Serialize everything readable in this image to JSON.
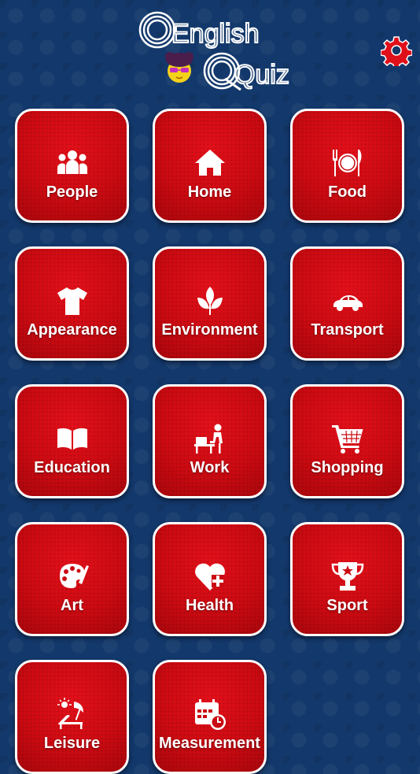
{
  "app": {
    "logo_line1": "English",
    "logo_line2": "Quiz"
  },
  "header": {
    "settings_icon": "gear-icon"
  },
  "colors": {
    "background": "#13386b",
    "tile": "#d50b14",
    "tile_border": "#ffffff",
    "settings": "#e0101a"
  },
  "categories": [
    {
      "label": "People",
      "icon": "people-icon"
    },
    {
      "label": "Home",
      "icon": "home-icon"
    },
    {
      "label": "Food",
      "icon": "food-icon"
    },
    {
      "label": "Appearance",
      "icon": "tshirt-icon"
    },
    {
      "label": "Environment",
      "icon": "leaves-icon"
    },
    {
      "label": "Transport",
      "icon": "car-icon"
    },
    {
      "label": "Education",
      "icon": "book-icon"
    },
    {
      "label": "Work",
      "icon": "desk-worker-icon"
    },
    {
      "label": "Shopping",
      "icon": "shopping-cart-icon"
    },
    {
      "label": "Art",
      "icon": "palette-icon"
    },
    {
      "label": "Health",
      "icon": "heart-plus-icon"
    },
    {
      "label": "Sport",
      "icon": "trophy-icon"
    },
    {
      "label": "Leisure",
      "icon": "sunbed-icon"
    },
    {
      "label": "Measurement",
      "icon": "calendar-clock-icon"
    }
  ]
}
